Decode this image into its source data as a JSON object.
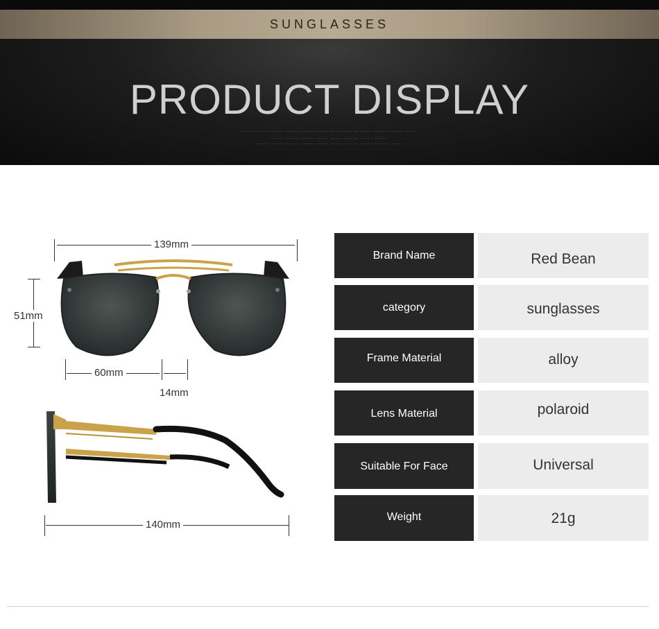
{
  "banner": {
    "top_label": "SUNGLASSES",
    "title": "PRODUCT DISPLAY"
  },
  "dimensions": {
    "total_width": "139mm",
    "height": "51mm",
    "lens_width": "60mm",
    "bridge": "14mm",
    "temple_length": "140mm"
  },
  "specs": [
    {
      "label": "Brand Name",
      "value": "Red Bean"
    },
    {
      "label": "category",
      "value": "sunglasses"
    },
    {
      "label": "Frame Material",
      "value": "alloy"
    },
    {
      "label": "Lens Material",
      "value": "polaroid"
    },
    {
      "label": "Suitable For Face",
      "value": "Universal"
    },
    {
      "label": "Weight",
      "value": "21g"
    }
  ],
  "colors": {
    "banner_bg": "#1d1d1d",
    "gold_bar": "#a89a83",
    "title": "#cfcfcf",
    "spec_key_bg": "#262626",
    "spec_value_bg": "#ececec"
  }
}
